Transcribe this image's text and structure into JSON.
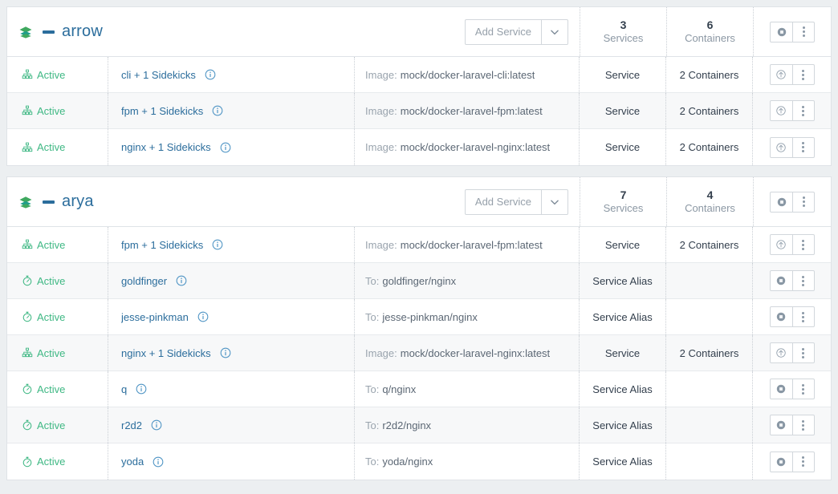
{
  "theme": {
    "page_bg": "#eceff1",
    "card_bg": "#ffffff",
    "row_alt_bg": "#f7f8f9",
    "link_blue": "#2b6d9c",
    "status_green": "#3fb884",
    "muted_gray": "#9aa4ae",
    "border_gray": "#dfe3e7",
    "stack_icon_green": "#3fa85f",
    "info_icon_blue": "#4b92c3"
  },
  "icons": {
    "stack": "stack-layers-icon",
    "collapse": "collapse-minus-icon",
    "caret": "chevron-down-icon",
    "info": "info-circle-icon",
    "service_status": "sitemap-icon",
    "alias_status": "stopwatch-icon",
    "stop": "stop-circle-icon",
    "upgrade": "upgrade-arrow-circle-icon",
    "kebab": "vertical-dots-icon"
  },
  "stacks": [
    {
      "name": "arrow",
      "add_button_label": "Add Service",
      "stats": [
        {
          "num": "3",
          "label": "Services"
        },
        {
          "num": "6",
          "label": "Containers"
        }
      ],
      "rows": [
        {
          "status": "Active",
          "status_icon": "sitemap-icon",
          "name": "cli + 1 Sidekicks",
          "detail_label": "Image:",
          "detail_value": "mock/docker-laravel-cli:latest",
          "type": "Service",
          "count": "2 Containers",
          "action_icon": "upgrade-arrow-circle-icon"
        },
        {
          "status": "Active",
          "status_icon": "sitemap-icon",
          "name": "fpm + 1 Sidekicks",
          "detail_label": "Image:",
          "detail_value": "mock/docker-laravel-fpm:latest",
          "type": "Service",
          "count": "2 Containers",
          "action_icon": "upgrade-arrow-circle-icon"
        },
        {
          "status": "Active",
          "status_icon": "sitemap-icon",
          "name": "nginx + 1 Sidekicks",
          "detail_label": "Image:",
          "detail_value": "mock/docker-laravel-nginx:latest",
          "type": "Service",
          "count": "2 Containers",
          "action_icon": "upgrade-arrow-circle-icon"
        }
      ]
    },
    {
      "name": "arya",
      "add_button_label": "Add Service",
      "stats": [
        {
          "num": "7",
          "label": "Services"
        },
        {
          "num": "4",
          "label": "Containers"
        }
      ],
      "rows": [
        {
          "status": "Active",
          "status_icon": "sitemap-icon",
          "name": "fpm + 1 Sidekicks",
          "detail_label": "Image:",
          "detail_value": "mock/docker-laravel-fpm:latest",
          "type": "Service",
          "count": "2 Containers",
          "action_icon": "upgrade-arrow-circle-icon"
        },
        {
          "status": "Active",
          "status_icon": "stopwatch-icon",
          "name": "goldfinger",
          "detail_label": "To:",
          "detail_value": "goldfinger/nginx",
          "type": "Service Alias",
          "count": "",
          "action_icon": "stop-circle-icon"
        },
        {
          "status": "Active",
          "status_icon": "stopwatch-icon",
          "name": "jesse-pinkman",
          "detail_label": "To:",
          "detail_value": "jesse-pinkman/nginx",
          "type": "Service Alias",
          "count": "",
          "action_icon": "stop-circle-icon"
        },
        {
          "status": "Active",
          "status_icon": "sitemap-icon",
          "name": "nginx + 1 Sidekicks",
          "detail_label": "Image:",
          "detail_value": "mock/docker-laravel-nginx:latest",
          "type": "Service",
          "count": "2 Containers",
          "action_icon": "upgrade-arrow-circle-icon"
        },
        {
          "status": "Active",
          "status_icon": "stopwatch-icon",
          "name": "q",
          "detail_label": "To:",
          "detail_value": "q/nginx",
          "type": "Service Alias",
          "count": "",
          "action_icon": "stop-circle-icon"
        },
        {
          "status": "Active",
          "status_icon": "stopwatch-icon",
          "name": "r2d2",
          "detail_label": "To:",
          "detail_value": "r2d2/nginx",
          "type": "Service Alias",
          "count": "",
          "action_icon": "stop-circle-icon"
        },
        {
          "status": "Active",
          "status_icon": "stopwatch-icon",
          "name": "yoda",
          "detail_label": "To:",
          "detail_value": "yoda/nginx",
          "type": "Service Alias",
          "count": "",
          "action_icon": "stop-circle-icon"
        }
      ]
    }
  ]
}
